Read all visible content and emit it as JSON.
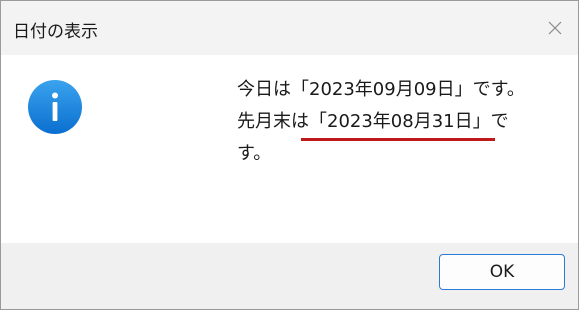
{
  "dialog": {
    "title": "日付の表示",
    "close_icon": "close-icon",
    "info_icon": "information-icon",
    "message": {
      "line1": "今日は「2023年09月09日」です。",
      "line2_prefix": "先月末は",
      "line2_highlight": "「2023年08月31日」",
      "line2_suffix": "で",
      "line3": "す。"
    },
    "ok_label": "OK"
  },
  "colors": {
    "accent": "#2b7bd6",
    "underline": "#c0191c",
    "info_icon": "#1c86e0"
  }
}
